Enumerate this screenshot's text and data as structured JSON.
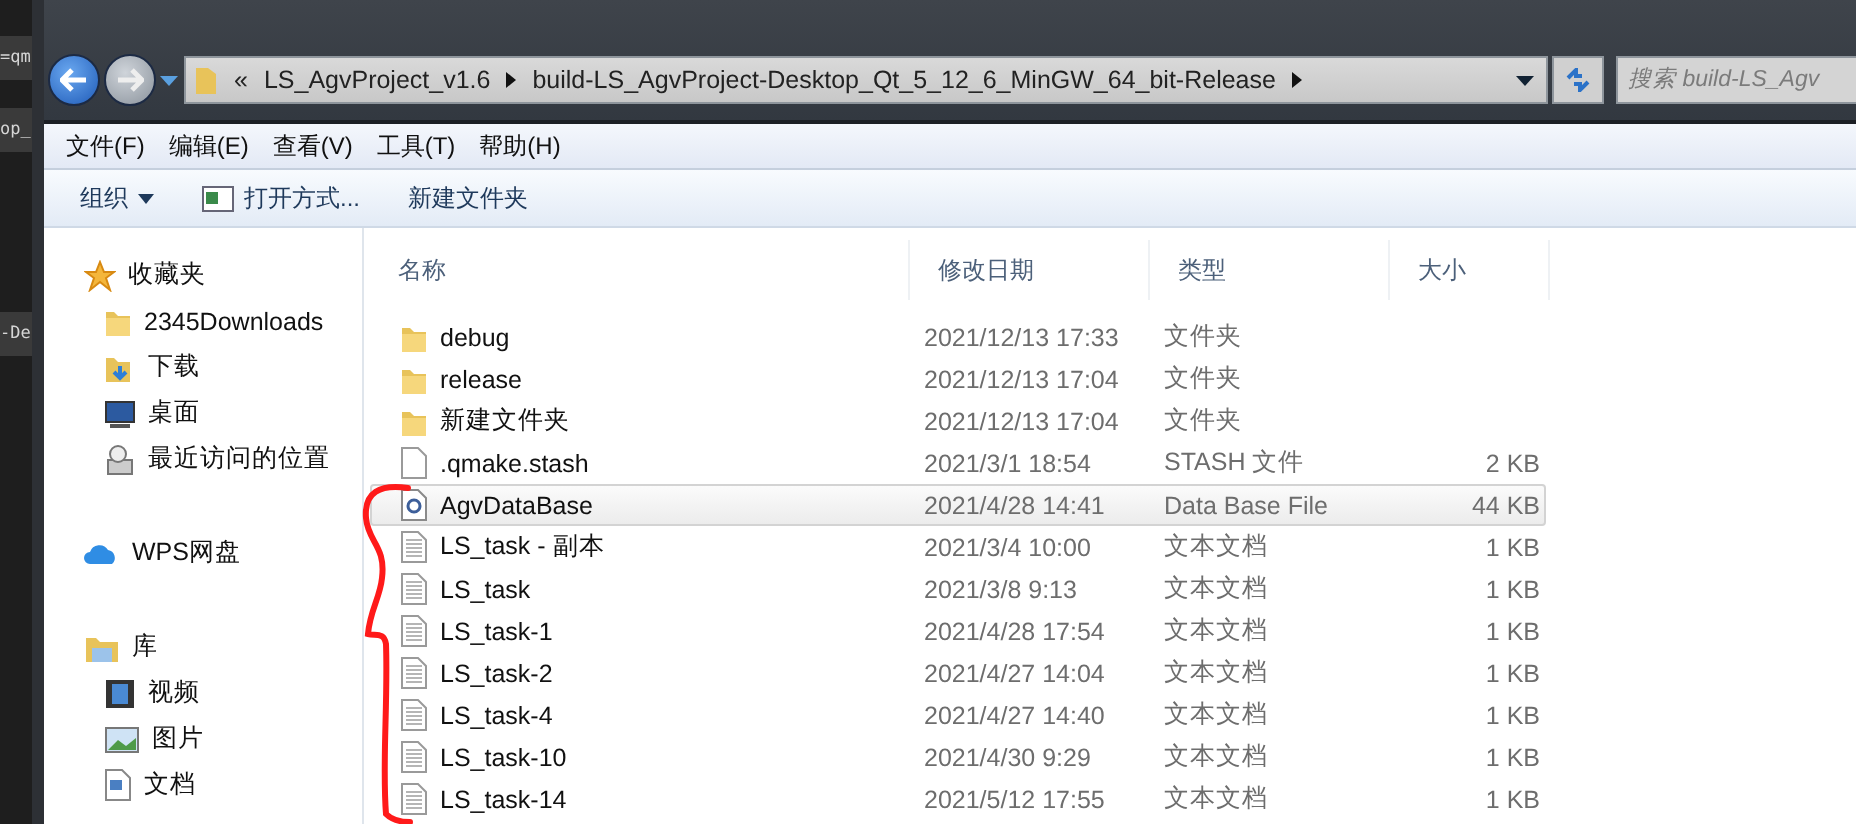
{
  "editor_lines": [
    "=qm",
    "op_",
    "-De"
  ],
  "nav": {
    "path": [
      {
        "label": "«",
        "kind": "overflow"
      },
      {
        "label": "LS_AgvProject_v1.6",
        "kind": "crumb"
      },
      {
        "label": "build-LS_AgvProject-Desktop_Qt_5_12_6_MinGW_64_bit-Release",
        "kind": "crumb"
      }
    ],
    "search": {
      "placeholder": "搜索 build-LS_Agv"
    }
  },
  "menu": [
    "文件(F)",
    "编辑(E)",
    "查看(V)",
    "工具(T)",
    "帮助(H)"
  ],
  "toolbar": [
    {
      "label": "组织",
      "kind": "dropdown"
    },
    {
      "label": "打开方式...",
      "kind": "open"
    },
    {
      "label": "新建文件夹",
      "kind": "plain"
    }
  ],
  "sidebar": [
    {
      "label": "收藏夹",
      "kind": "star",
      "children": [
        {
          "label": "2345Downloads",
          "kind": "folder"
        },
        {
          "label": "下载",
          "kind": "download"
        },
        {
          "label": "桌面",
          "kind": "desktop"
        },
        {
          "label": "最近访问的位置",
          "kind": "recent"
        }
      ]
    },
    {
      "label": "WPS网盘",
      "kind": "cloud"
    },
    {
      "label": "库",
      "kind": "library",
      "children": [
        {
          "label": "视频",
          "kind": "video"
        },
        {
          "label": "图片",
          "kind": "image"
        },
        {
          "label": "文档",
          "kind": "doc"
        }
      ]
    }
  ],
  "table": {
    "columns": [
      "名称",
      "修改日期",
      "类型",
      "大小"
    ],
    "rows": [
      {
        "name": "debug",
        "date": "2021/12/13 17:33",
        "type": "文件夹",
        "kind": "folder",
        "selected": false
      },
      {
        "name": "release",
        "date": "2021/12/13 17:04",
        "type": "文件夹",
        "kind": "folder",
        "selected": false
      },
      {
        "name": "新建文件夹",
        "date": "2021/12/13 17:04",
        "type": "文件夹",
        "kind": "folder",
        "selected": false
      },
      {
        "name": ".qmake.stash",
        "date": "2021/3/1 18:54",
        "type": "STASH 文件",
        "size": "2 KB",
        "kind": "file",
        "selected": false
      },
      {
        "name": "AgvDataBase",
        "date": "2021/4/28 14:41",
        "type": "Data Base File",
        "size": "44 KB",
        "kind": "database",
        "selected": true
      },
      {
        "name": "LS_task - 副本",
        "date": "2021/3/4 10:00",
        "type": "文本文档",
        "size": "1 KB",
        "kind": "text",
        "selected": false
      },
      {
        "name": "LS_task",
        "date": "2021/3/8 9:13",
        "type": "文本文档",
        "size": "1 KB",
        "kind": "text",
        "selected": false
      },
      {
        "name": "LS_task-1",
        "date": "2021/4/28 17:54",
        "type": "文本文档",
        "size": "1 KB",
        "kind": "text",
        "selected": false
      },
      {
        "name": "LS_task-2",
        "date": "2021/4/27 14:04",
        "type": "文本文档",
        "size": "1 KB",
        "kind": "text",
        "selected": false
      },
      {
        "name": "LS_task-4",
        "date": "2021/4/27 14:40",
        "type": "文本文档",
        "size": "1 KB",
        "kind": "text",
        "selected": false
      },
      {
        "name": "LS_task-10",
        "date": "2021/4/30 9:29",
        "type": "文本文档",
        "size": "1 KB",
        "kind": "text",
        "selected": false
      },
      {
        "name": "LS_task-14",
        "date": "2021/5/12 17:55",
        "type": "文本文档",
        "size": "1 KB",
        "kind": "text",
        "selected": false
      }
    ]
  }
}
